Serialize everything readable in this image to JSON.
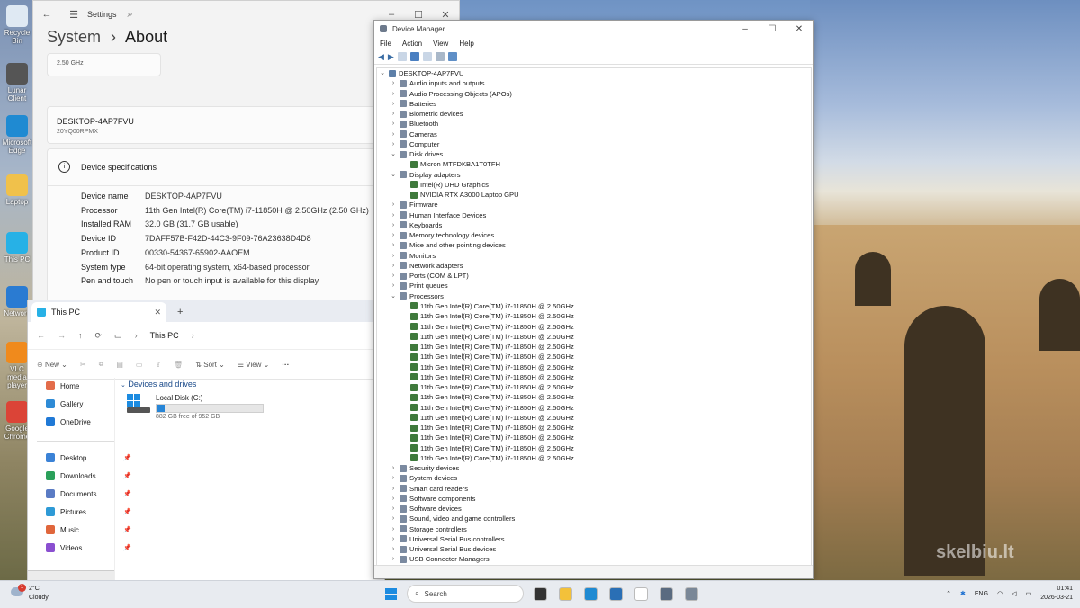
{
  "desktop": {
    "icons": [
      {
        "label": "Recycle Bin",
        "color": "#dfe9f3"
      },
      {
        "label": "Lunar Client",
        "color": "#555555"
      },
      {
        "label": "Microsoft Edge",
        "color": "#1f8ad2"
      },
      {
        "label": "Laptop",
        "color": "#f0c14b"
      },
      {
        "label": "This PC",
        "color": "#27b1e6"
      },
      {
        "label": "Network",
        "color": "#2a7bd2"
      },
      {
        "label": "VLC media player",
        "color": "#f08a1c"
      },
      {
        "label": "Google Chrome",
        "color": "#db4437"
      }
    ],
    "watermark": "skelbiu.lt"
  },
  "settings": {
    "title": "Settings",
    "breadcrumb_parent": "System",
    "breadcrumb_sep": "›",
    "breadcrumb_current": "About",
    "speed_snippet": "2.50 GHz",
    "device_name_header": "DESKTOP-4AP7FVU",
    "device_model": "20YQ00RPMX",
    "rename_btn": "R",
    "spec_section_title": "Device specifications",
    "specs": [
      {
        "label": "Device name",
        "value": "DESKTOP-4AP7FVU"
      },
      {
        "label": "Processor",
        "value": "11th Gen Intel(R) Core(TM) i7-11850H @ 2.50GHz (2.50 GHz)"
      },
      {
        "label": "Installed RAM",
        "value": "32.0 GB (31.7 GB usable)"
      },
      {
        "label": "Device ID",
        "value": "7DAFF57B-F42D-44C3-9F09-76A23638D4D8"
      },
      {
        "label": "Product ID",
        "value": "00330-54367-65902-AAOEM"
      },
      {
        "label": "System type",
        "value": "64-bit operating system, x64-based processor"
      },
      {
        "label": "Pen and touch",
        "value": "No pen or touch input is available for this display"
      }
    ]
  },
  "explorer": {
    "tab_title": "This PC",
    "tab_close": "✕",
    "new_tab": "+",
    "address": "This PC",
    "cmd_new": "New",
    "cmd_sort": "Sort",
    "cmd_view": "View",
    "cmd_more": "···",
    "section_title": "Devices and drives",
    "drive_name": "Local Disk (C:)",
    "drive_free": "882 GB free of 952 GB",
    "drive_used_fraction": 0.074,
    "nav": [
      {
        "label": "Home",
        "color": "#e36c4a",
        "pin": false
      },
      {
        "label": "Gallery",
        "color": "#2e8bd6",
        "pin": false
      },
      {
        "label": "OneDrive",
        "color": "#2079d6",
        "pin": false
      },
      {
        "label": "Desktop",
        "color": "#3b82d6",
        "pin": true
      },
      {
        "label": "Downloads",
        "color": "#2aa05a",
        "pin": true
      },
      {
        "label": "Documents",
        "color": "#5a7bc4",
        "pin": true
      },
      {
        "label": "Pictures",
        "color": "#2e9ad6",
        "pin": true
      },
      {
        "label": "Music",
        "color": "#e0663c",
        "pin": true
      },
      {
        "label": "Videos",
        "color": "#8a4fd0",
        "pin": true
      }
    ]
  },
  "device_manager": {
    "title": "Device Manager",
    "menu": [
      "File",
      "Action",
      "View",
      "Help"
    ],
    "root": "DESKTOP-4AP7FVU",
    "categories": [
      {
        "label": "Audio inputs and outputs",
        "expanded": false
      },
      {
        "label": "Audio Processing Objects (APOs)",
        "expanded": false
      },
      {
        "label": "Batteries",
        "expanded": false
      },
      {
        "label": "Biometric devices",
        "expanded": false
      },
      {
        "label": "Bluetooth",
        "expanded": false
      },
      {
        "label": "Cameras",
        "expanded": false
      },
      {
        "label": "Computer",
        "expanded": false
      },
      {
        "label": "Disk drives",
        "expanded": true,
        "children": [
          "Micron MTFDKBA1T0TFH"
        ]
      },
      {
        "label": "Display adapters",
        "expanded": true,
        "children": [
          "Intel(R) UHD Graphics",
          "NVIDIA RTX A3000 Laptop GPU"
        ]
      },
      {
        "label": "Firmware",
        "expanded": false
      },
      {
        "label": "Human Interface Devices",
        "expanded": false
      },
      {
        "label": "Keyboards",
        "expanded": false
      },
      {
        "label": "Memory technology devices",
        "expanded": false
      },
      {
        "label": "Mice and other pointing devices",
        "expanded": false
      },
      {
        "label": "Monitors",
        "expanded": false
      },
      {
        "label": "Network adapters",
        "expanded": false
      },
      {
        "label": "Ports (COM & LPT)",
        "expanded": false
      },
      {
        "label": "Print queues",
        "expanded": false
      },
      {
        "label": "Processors",
        "expanded": true,
        "children": [
          "11th Gen Intel(R) Core(TM) i7-11850H @ 2.50GHz",
          "11th Gen Intel(R) Core(TM) i7-11850H @ 2.50GHz",
          "11th Gen Intel(R) Core(TM) i7-11850H @ 2.50GHz",
          "11th Gen Intel(R) Core(TM) i7-11850H @ 2.50GHz",
          "11th Gen Intel(R) Core(TM) i7-11850H @ 2.50GHz",
          "11th Gen Intel(R) Core(TM) i7-11850H @ 2.50GHz",
          "11th Gen Intel(R) Core(TM) i7-11850H @ 2.50GHz",
          "11th Gen Intel(R) Core(TM) i7-11850H @ 2.50GHz",
          "11th Gen Intel(R) Core(TM) i7-11850H @ 2.50GHz",
          "11th Gen Intel(R) Core(TM) i7-11850H @ 2.50GHz",
          "11th Gen Intel(R) Core(TM) i7-11850H @ 2.50GHz",
          "11th Gen Intel(R) Core(TM) i7-11850H @ 2.50GHz",
          "11th Gen Intel(R) Core(TM) i7-11850H @ 2.50GHz",
          "11th Gen Intel(R) Core(TM) i7-11850H @ 2.50GHz",
          "11th Gen Intel(R) Core(TM) i7-11850H @ 2.50GHz",
          "11th Gen Intel(R) Core(TM) i7-11850H @ 2.50GHz"
        ]
      },
      {
        "label": "Security devices",
        "expanded": false
      },
      {
        "label": "System devices",
        "expanded": false
      },
      {
        "label": "Smart card readers",
        "expanded": false
      },
      {
        "label": "Software components",
        "expanded": false
      },
      {
        "label": "Software devices",
        "expanded": false
      },
      {
        "label": "Sound, video and game controllers",
        "expanded": false
      },
      {
        "label": "Storage controllers",
        "expanded": false
      },
      {
        "label": "Universal Serial Bus controllers",
        "expanded": false
      },
      {
        "label": "Universal Serial Bus devices",
        "expanded": false
      },
      {
        "label": "USB Connector Managers",
        "expanded": false
      }
    ]
  },
  "taskbar": {
    "weather_temp": "2°C",
    "weather_desc": "Cloudy",
    "weather_badge": "1",
    "search_placeholder": "Search",
    "lang": "ENG",
    "time": "01:41",
    "date": "2026-03-21",
    "apps": [
      {
        "name": "task-view",
        "color": "#333333"
      },
      {
        "name": "file-explorer",
        "color": "#f3c13a"
      },
      {
        "name": "edge",
        "color": "#1f8ad2"
      },
      {
        "name": "store",
        "color": "#2a6fb5"
      },
      {
        "name": "notepad",
        "color": "#ffffff"
      },
      {
        "name": "settings",
        "color": "#5a6b80"
      },
      {
        "name": "device-manager",
        "color": "#7a8797"
      }
    ]
  }
}
